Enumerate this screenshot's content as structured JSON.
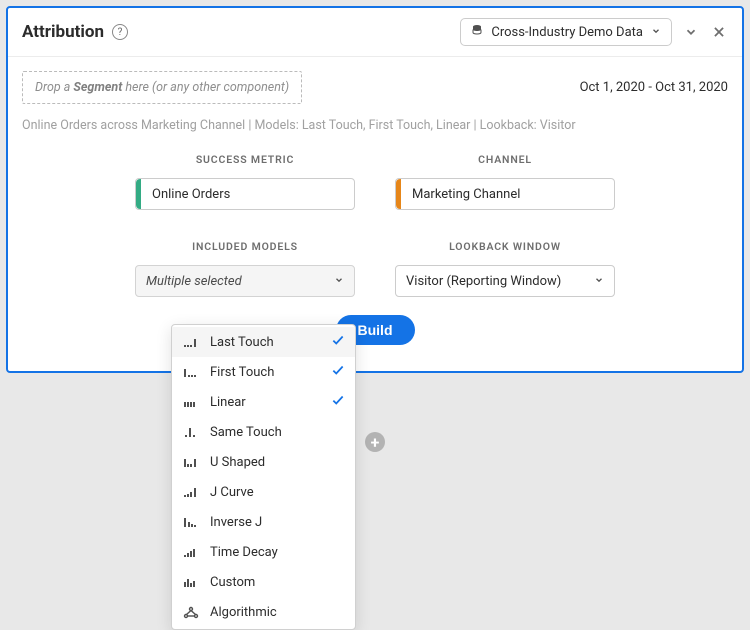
{
  "header": {
    "title": "Attribution",
    "data_source": "Cross-Industry Demo Data"
  },
  "dropzone": {
    "prefix": "Drop a ",
    "bold": "Segment",
    "suffix": " here (or any other component)"
  },
  "date_range": "Oct 1, 2020 - Oct 31, 2020",
  "subtitle": "Online Orders across Marketing Channel | Models: Last Touch, First Touch, Linear | Lookback: Visitor",
  "labels": {
    "success_metric": "SUCCESS METRIC",
    "channel": "CHANNEL",
    "included_models": "INCLUDED MODELS",
    "lookback_window": "LOOKBACK WINDOW"
  },
  "fields": {
    "success_metric": "Online Orders",
    "channel": "Marketing Channel",
    "included_models_selected": "Multiple selected",
    "lookback_window": "Visitor (Reporting Window)"
  },
  "build_label": "Build",
  "models": [
    {
      "label": "Last Touch",
      "checked": true,
      "hover": true
    },
    {
      "label": "First Touch",
      "checked": true,
      "hover": false
    },
    {
      "label": "Linear",
      "checked": true,
      "hover": false
    },
    {
      "label": "Same Touch",
      "checked": false,
      "hover": false
    },
    {
      "label": "U Shaped",
      "checked": false,
      "hover": false
    },
    {
      "label": "J Curve",
      "checked": false,
      "hover": false
    },
    {
      "label": "Inverse J",
      "checked": false,
      "hover": false
    },
    {
      "label": "Time Decay",
      "checked": false,
      "hover": false
    },
    {
      "label": "Custom",
      "checked": false,
      "hover": false
    },
    {
      "label": "Algorithmic",
      "checked": false,
      "hover": false
    }
  ]
}
